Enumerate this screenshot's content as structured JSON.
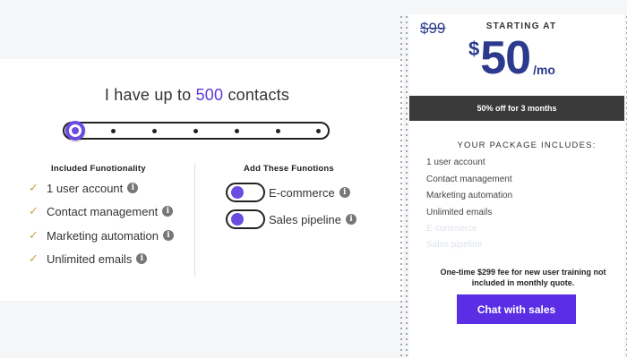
{
  "contacts": {
    "prefix": "I have up to",
    "value": "500",
    "suffix": "contacts",
    "slider_stops": 7,
    "slider_selected_index": 0
  },
  "included": {
    "title": "Included Funotionality",
    "items": [
      {
        "label": "1 user account",
        "icon": "info-icon"
      },
      {
        "label": "Contact management",
        "icon": "info-icon"
      },
      {
        "label": "Marketing automation",
        "icon": "info-icon"
      },
      {
        "label": "Unlimited emails",
        "icon": "info-icon"
      }
    ]
  },
  "addons": {
    "title": "Add These Funotions",
    "items": [
      {
        "label": "E-commerce",
        "enabled": false
      },
      {
        "label": "Sales pipeline",
        "enabled": false
      }
    ]
  },
  "pricing": {
    "old_price": "$99",
    "starting_label": "STARTING AT",
    "currency": "$",
    "amount": "50",
    "period": "/mo",
    "promo": "50% off for 3 months",
    "package_title": "YOUR PACKAGE INCLUDES:",
    "package_items": [
      {
        "label": "1 user account",
        "active": true
      },
      {
        "label": "Contact management",
        "active": true
      },
      {
        "label": "Marketing automation",
        "active": true
      },
      {
        "label": "Unlimited emails",
        "active": true
      },
      {
        "label": "E-commerce",
        "active": false
      },
      {
        "label": "Sales pipeline",
        "active": false
      }
    ],
    "note": "One-time $299 fee for new user training not included in monthly quote.",
    "cta": "Chat with sales"
  },
  "colors": {
    "accent": "#5b2ee6",
    "price": "#2b3a8c",
    "check": "#c9a24a",
    "promo_bg": "#3a3a3a"
  }
}
